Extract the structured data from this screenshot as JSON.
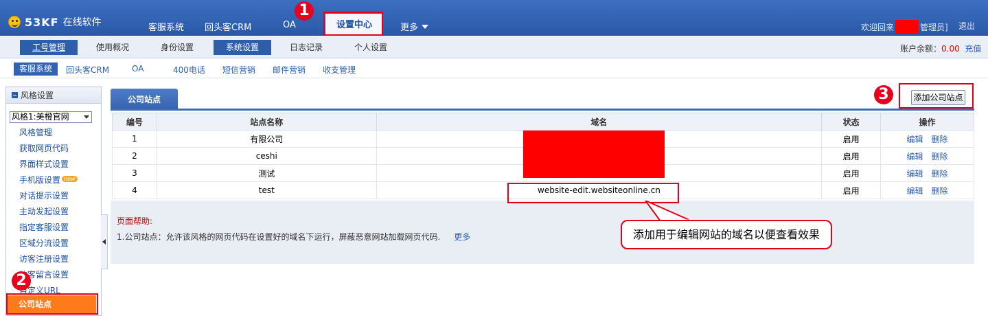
{
  "header": {
    "logo_name": "53KF",
    "logo_sub": "在线软件",
    "nav": [
      "客服系统",
      "回头客CRM",
      "OA",
      "设置中心",
      "更多"
    ],
    "welcome_prefix": "欢迎回来",
    "welcome_suffix": "管理员]",
    "logout": "退出"
  },
  "subnav": {
    "tabs": [
      "工号管理",
      "使用概况",
      "身份设置",
      "系统设置",
      "日志记录",
      "个人设置"
    ],
    "balance_label": "账户余额：",
    "balance_value": "0.00",
    "recharge": "充值"
  },
  "products": [
    "客服系统",
    "回头客CRM",
    "OA",
    "400电话",
    "短信营销",
    "邮件营销",
    "收支管理"
  ],
  "sidebar": {
    "header": "风格设置",
    "select_value": "风格1:美橙官网",
    "items": [
      "风格管理",
      "获取网页代码",
      "界面样式设置",
      "手机版设置",
      "对话提示设置",
      "主动发起设置",
      "指定客服设置",
      "区域分流设置",
      "访客注册设置",
      "访客留言设置",
      "自定义URL",
      "公司站点"
    ],
    "new_badge": "new"
  },
  "main": {
    "tab": "公司站点",
    "add_button": "添加公司站点",
    "columns": [
      "编号",
      "站点名称",
      "域名",
      "状态",
      "操作"
    ],
    "rows": [
      {
        "id": "1",
        "name": "有限公司",
        "domain": "",
        "status": "启用"
      },
      {
        "id": "2",
        "name": "ceshi",
        "domain": "",
        "status": "启用"
      },
      {
        "id": "3",
        "name": "测试",
        "domain": "",
        "status": "启用"
      },
      {
        "id": "4",
        "name": "test",
        "domain": "website-edit.websiteonline.cn",
        "status": "启用"
      }
    ],
    "op_edit": "编辑",
    "op_delete": "删除",
    "help_title": "页面帮助:",
    "help_text": "1.公司站点：允许该风格的网页代码在设置好的域名下运行，屏蔽恶意网站加载网页代码.",
    "help_more": "更多"
  },
  "annotations": {
    "n1": "1",
    "n2": "2",
    "n3": "3",
    "callout": "添加用于编辑网站的域名以便查看效果"
  }
}
